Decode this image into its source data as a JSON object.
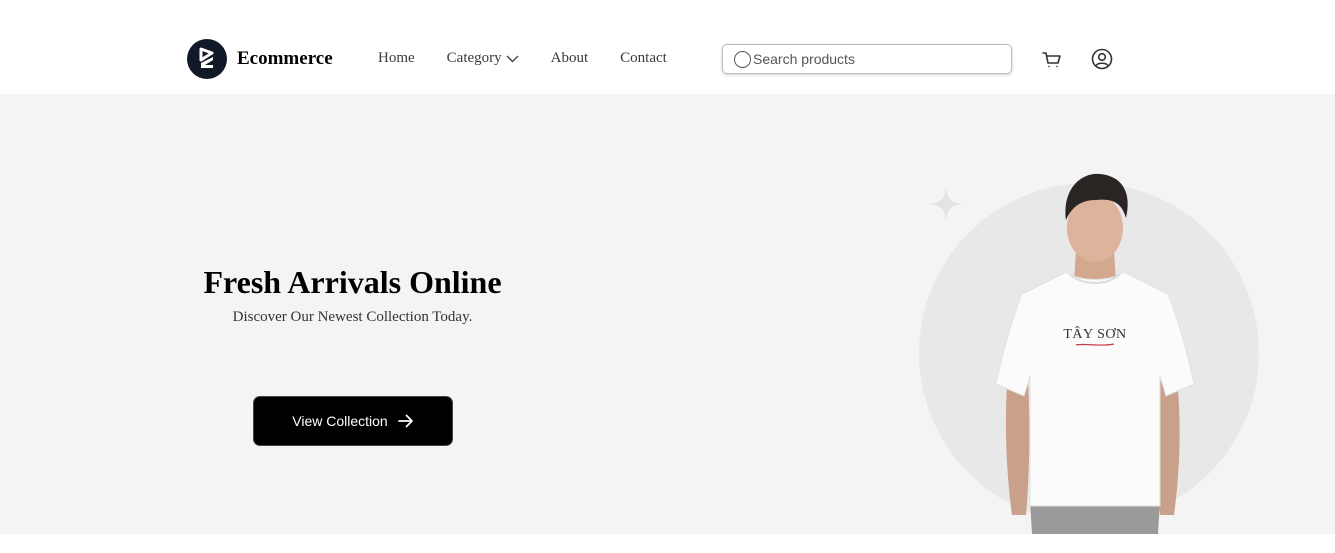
{
  "brand": {
    "name": "Ecommerce",
    "logo_icon": "ecommerce-logo-icon"
  },
  "nav": {
    "items": [
      {
        "label": "Home"
      },
      {
        "label": "Category",
        "icon": "chevron-down-icon"
      },
      {
        "label": "About"
      },
      {
        "label": "Contact"
      }
    ]
  },
  "search": {
    "placeholder": "Search products",
    "value": ""
  },
  "header_icons": {
    "cart": "cart-icon",
    "user": "user-icon"
  },
  "hero": {
    "title": "Fresh Arrivals Online",
    "subtitle": "Discover Our Newest Collection Today.",
    "cta_label": "View Collection",
    "image_text": "TÂY SƠN"
  },
  "colors": {
    "hero_bg": "#f4f4f4",
    "button_bg": "#000000",
    "logo_bg": "#111827"
  }
}
